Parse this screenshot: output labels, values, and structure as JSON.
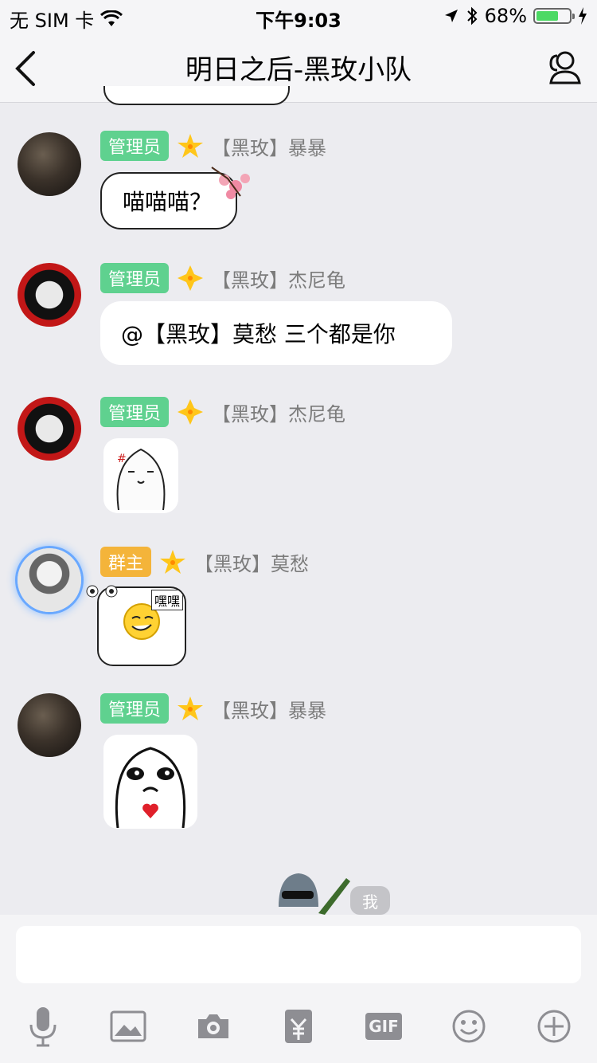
{
  "status_bar": {
    "carrier": "无 SIM 卡",
    "time": "下午9:03",
    "battery": "68%",
    "battery_level": 0.68
  },
  "nav": {
    "title": "明日之后-黑玫小队",
    "back_icon": "back-chevron-icon",
    "members_icon": "group-members-icon"
  },
  "messages": [
    {
      "badge": "管理员",
      "sender": "【黑玫】暴暴",
      "text": "喵喵喵？"
    },
    {
      "badge": "管理员",
      "sender": "【黑玫】杰尼龟",
      "text": "@【黑玫】莫愁 三个都是你"
    },
    {
      "badge": "管理员",
      "sender": "【黑玫】杰尼龟",
      "sticker": "blush-face-sticker"
    },
    {
      "badge": "群主",
      "sender": "【黑玫】莫愁",
      "sticker_text": "嘿嘿"
    },
    {
      "badge": "管理员",
      "sender": "【黑玫】暴暴",
      "sticker": "heart-face-sticker"
    }
  ],
  "self_tag": "我",
  "toolbar": {
    "icons": [
      "microphone-icon",
      "image-icon",
      "camera-icon",
      "red-packet-icon",
      "gif-icon",
      "emoji-icon",
      "plus-icon"
    ],
    "gif_label": "GIF"
  },
  "colors": {
    "admin_badge": "#5fd18f",
    "owner_badge": "#f4b43a",
    "background": "#ececf0"
  }
}
